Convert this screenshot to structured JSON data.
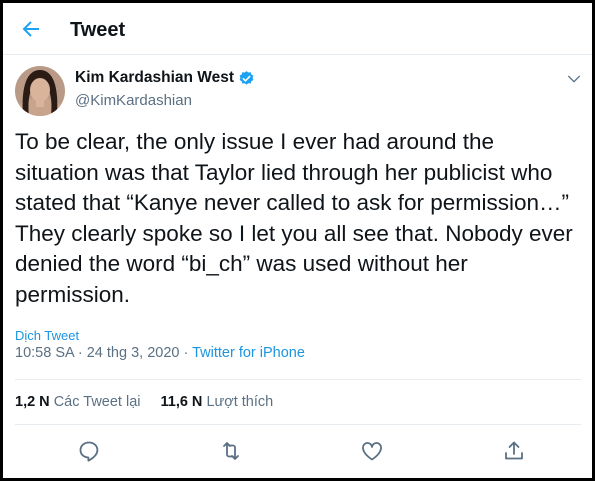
{
  "header": {
    "title": "Tweet",
    "back_icon": "arrow-left-icon"
  },
  "author": {
    "name": "Kim Kardashian West",
    "handle": "@KimKardashian",
    "verified_icon": "verified-badge-icon"
  },
  "tweet": {
    "lines": [
      "To be clear, the only issue I ever had around the",
      "situation was that Taylor lied through her publicist who",
      "stated that “Kanye never called to ask for permission…”",
      "They clearly spoke so I let you all see that. Nobody ever",
      "denied the word “bi_ch” was used without her",
      "permission."
    ],
    "translate_label": "Dịch Tweet",
    "timestamp": "10:58 SA · 24 thg 3, 2020 · ",
    "source": "Twitter for iPhone"
  },
  "stats": {
    "retweets_count": "1,2 N",
    "retweets_label": "Các Tweet lại",
    "likes_count": "11,6 N",
    "likes_label": "Lượt thích"
  },
  "actions": [
    "reply-icon",
    "retweet-icon",
    "like-icon",
    "share-icon"
  ],
  "colors": {
    "accent": "#1b95e0",
    "muted": "#5b7083",
    "divider": "#e6ecf0"
  }
}
